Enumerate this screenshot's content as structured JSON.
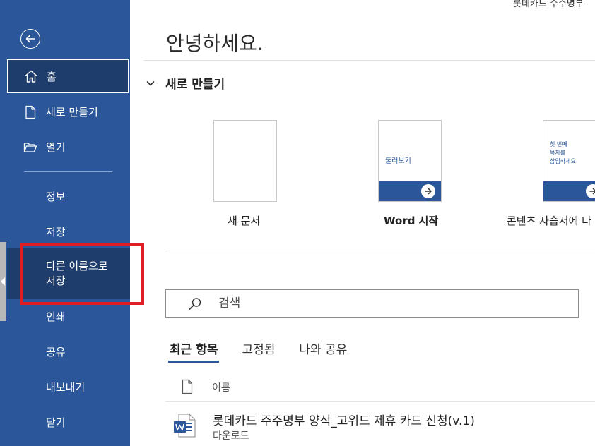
{
  "window": {
    "doc_title": "롯데카드 주주명부"
  },
  "sidebar": {
    "home": "홈",
    "new": "새로 만들기",
    "open": "열기",
    "info": "정보",
    "save": "저장",
    "save_as_line1": "다른 이름으로",
    "save_as_line2": "저장",
    "print": "인쇄",
    "share": "공유",
    "export": "내보내기",
    "close": "닫기"
  },
  "main": {
    "greeting": "안녕하세요.",
    "new_section_title": "새로 만들기",
    "templates": [
      {
        "label": "새 문서"
      },
      {
        "label": "Word 시작",
        "preview": "둘러보기"
      },
      {
        "label": "콘텐츠 자습서에 다",
        "preview_lines": [
          "첫 번째",
          "목차를",
          "삽입하세요"
        ]
      }
    ],
    "search": {
      "placeholder": "검색"
    },
    "tabs": [
      "최근 항목",
      "고정됨",
      "나와 공유"
    ],
    "column_name": "이름",
    "files": [
      {
        "name": "롯데카드 주주명부 양식_고위드 제휴 카드 신청(v.1)",
        "location": "다운로드"
      }
    ]
  },
  "colors": {
    "sidebar": "#2b579a",
    "selected": "#1e3d6d",
    "highlight": "#e01d22"
  }
}
